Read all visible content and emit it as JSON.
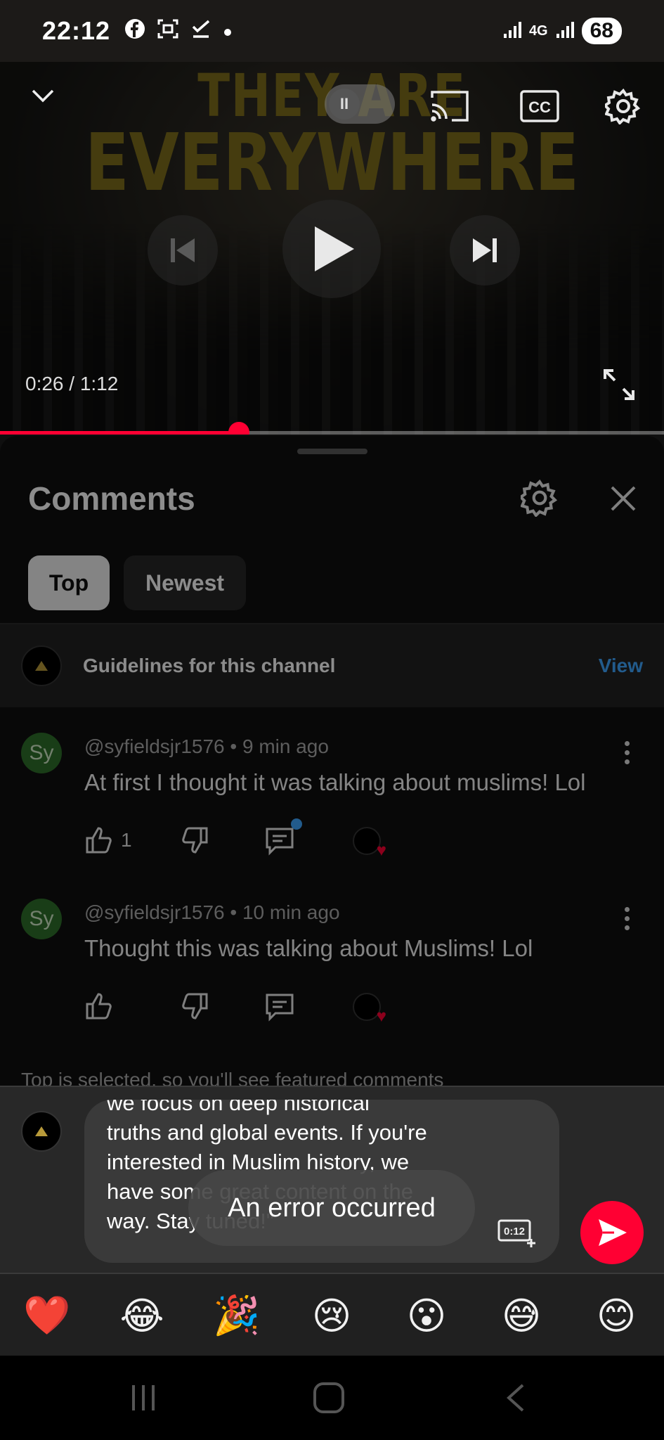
{
  "status_bar": {
    "time": "22:12",
    "network": "4G",
    "battery": "68",
    "icons": [
      "facebook-icon",
      "screenshot-icon",
      "check-icon",
      "dot-icon",
      "signal-icon"
    ]
  },
  "player": {
    "video_title_line1": "THEY ARE",
    "video_title_line2": "EVERYWHERE",
    "time_display": "0:26 / 1:12",
    "progress_fraction": 0.36,
    "pause_glyph": "II",
    "icons": [
      "chevron-down-icon",
      "cast-icon",
      "cc-icon",
      "settings-icon",
      "previous-icon",
      "play-icon",
      "next-icon",
      "fullscreen-icon"
    ]
  },
  "comments_panel": {
    "title": "Comments",
    "chips": [
      {
        "label": "Top",
        "selected": true
      },
      {
        "label": "Newest",
        "selected": false
      }
    ],
    "guidelines": {
      "label": "Guidelines for this channel",
      "action": "View"
    },
    "comments": [
      {
        "avatar_initials": "Sy",
        "author": "@syfieldsjr1576",
        "age": "9 min ago",
        "meta": "@syfieldsjr1576 • 9 min ago",
        "text": "At first I thought it was talking about muslims! Lol",
        "likes": "1",
        "has_new_reply": true,
        "creator_hearted": true
      },
      {
        "avatar_initials": "Sy",
        "author": "@syfieldsjr1576",
        "age": "10 min ago",
        "meta": "@syfieldsjr1576 • 10 min ago",
        "text": "Thought this was talking about Muslims! Lol",
        "likes": "",
        "has_new_reply": false,
        "creator_hearted": true
      }
    ],
    "featured_note": "Top is selected, so you'll see featured comments"
  },
  "composer": {
    "draft_text": "we focus on deep historical\ntruths and global events. If you're\ninterested in Muslim history, we\nhave some great content on the\nway. Stay tuned!\"",
    "timestamp_label": "0:12",
    "send_icon": "send-icon"
  },
  "toast": {
    "message": "An error occurred"
  },
  "emoji_bar": {
    "emojis": [
      "❤️",
      "😂",
      "🎉",
      "😢",
      "😮",
      "😅",
      "😊"
    ]
  },
  "nav_bar": {
    "icons": [
      "recents-icon",
      "home-icon",
      "back-icon"
    ]
  },
  "colors": {
    "accent_red": "#ff0033",
    "link_blue": "#3ea6ff",
    "title_gold": "#7f6d1c"
  }
}
